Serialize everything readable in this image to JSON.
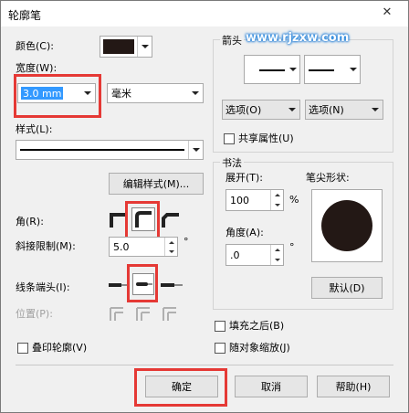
{
  "window": {
    "title": "轮廓笔",
    "close_glyph": "✕"
  },
  "watermark": "www.rjzxw.com",
  "color": {
    "label": "颜色(C):",
    "swatch": "#231815"
  },
  "width": {
    "label": "宽度(W):",
    "value": "3.0 mm",
    "unit": "毫米"
  },
  "style": {
    "label": "样式(L):",
    "edit_button": "编辑样式(M)..."
  },
  "corner": {
    "label": "角(R):"
  },
  "miter": {
    "label": "斜接限制(M):",
    "value": "5.0",
    "degree": "°"
  },
  "linecap": {
    "label": "线条端头(I):"
  },
  "position": {
    "label": "位置(P):"
  },
  "arrow": {
    "group": "箭头",
    "options_left": "选项(O)",
    "options_right": "选项(N)",
    "share": "共享属性(U)"
  },
  "calligraphy": {
    "group": "书法",
    "stretch_label": "展开(T):",
    "stretch_value": "100",
    "percent": "%",
    "angle_label": "角度(A):",
    "angle_value": ".0",
    "degree": "°",
    "nib_label": "笔尖形状:",
    "default_button": "默认(D)"
  },
  "checks": {
    "fill_behind": "填充之后(B)",
    "scale_with": "随对象缩放(J)",
    "overprint": "叠印轮廓(V)"
  },
  "footer": {
    "ok": "确定",
    "cancel": "取消",
    "help": "帮助(H)"
  }
}
